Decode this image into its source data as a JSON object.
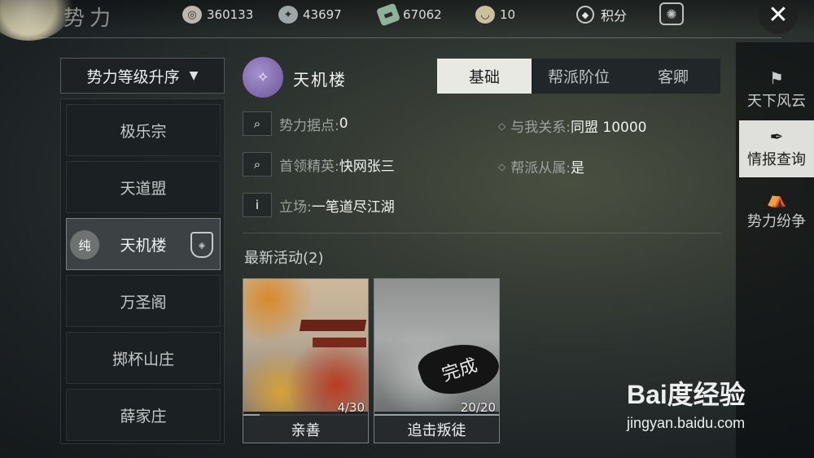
{
  "header": {
    "title": "势力",
    "resources": [
      {
        "icon": "coin-icon",
        "value": "360133"
      },
      {
        "icon": "silver-icon",
        "value": "43697"
      },
      {
        "icon": "jade-icon",
        "value": "67062"
      },
      {
        "icon": "bowl-icon",
        "value": "10"
      }
    ],
    "points_label": "积分"
  },
  "sort": {
    "label": "势力等级升序"
  },
  "factions": [
    {
      "name": "极乐宗"
    },
    {
      "name": "天道盟"
    },
    {
      "name": "天机楼",
      "tag": "纯"
    },
    {
      "name": "万圣阁"
    },
    {
      "name": "掷杯山庄"
    },
    {
      "name": "薛家庄"
    }
  ],
  "selected": {
    "name": "天机楼",
    "tabs": [
      "基础",
      "帮派阶位",
      "客卿"
    ],
    "active_tab": "基础",
    "stronghold_label": "势力据点:",
    "stronghold_value": "0",
    "relation_label": "与我关系:",
    "relation_value": "同盟 10000",
    "leader_label": "首领精英:",
    "leader_value": "快网张三",
    "affiliation_label": "帮派从属:",
    "affiliation_value": "是",
    "stance_label": "立场:",
    "stance_value": "一笔道尽江湖"
  },
  "activities": {
    "title": "最新活动(2)",
    "items": [
      {
        "name": "亲善",
        "progress_text": "4/30",
        "progress": 0.133
      },
      {
        "name": "追击叛徒",
        "progress_text": "20/20",
        "progress": 1.0,
        "stamp": "完成"
      }
    ]
  },
  "sidebar": {
    "items": [
      {
        "label": "天下风云",
        "icon": "banner-icon"
      },
      {
        "label": "情报查询",
        "icon": "quill-icon"
      },
      {
        "label": "势力纷争",
        "icon": "camp-icon"
      }
    ]
  },
  "watermark": {
    "brand": "Bai度经验",
    "site": "jingyan.baidu.com"
  }
}
